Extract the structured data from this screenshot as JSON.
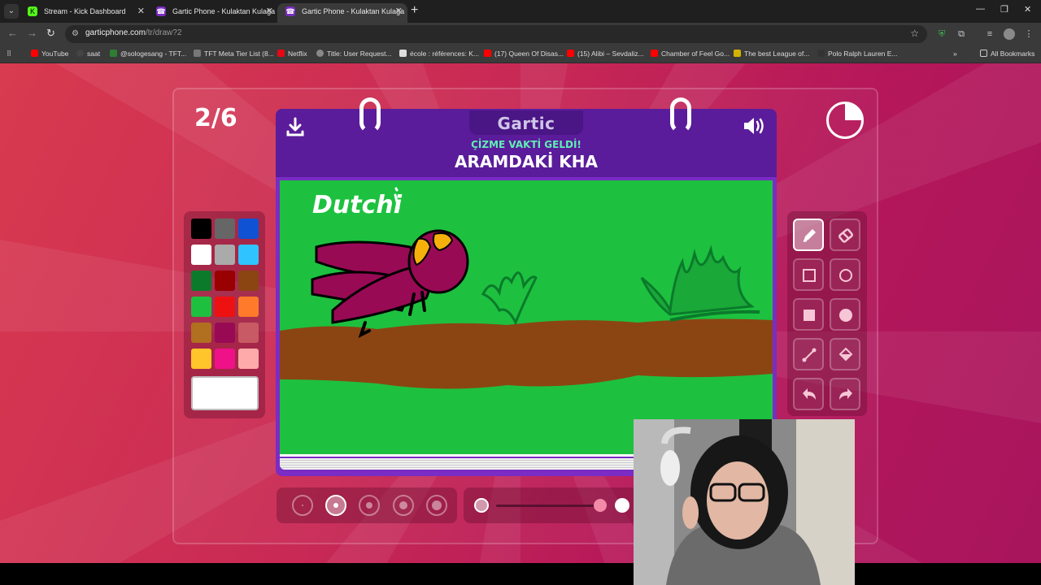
{
  "browser": {
    "tabs": [
      {
        "title": "Stream - Kick Dashboard",
        "active": false,
        "icon": "kick-icon"
      },
      {
        "title": "Gartic Phone - Kulaktan Kulağa",
        "active": false,
        "icon": "gartic-icon"
      },
      {
        "title": "Gartic Phone - Kulaktan Kulağa",
        "active": true,
        "icon": "gartic-icon"
      }
    ],
    "new_tab": "+",
    "url_host": "garticphone.com",
    "url_path": "/tr/draw?2",
    "bookmarks": [
      {
        "label": "YouTube",
        "color": "#ff0000"
      },
      {
        "label": "saat",
        "color": "#444444"
      },
      {
        "label": "@sologesang - TFT...",
        "color": "#2e7d32"
      },
      {
        "label": "TFT Meta Tier List (8...",
        "color": "#777777"
      },
      {
        "label": "Netflix",
        "color": "#e50914"
      },
      {
        "label": "Title: User Request...",
        "color": "#888888"
      },
      {
        "label": "école : références: K...",
        "color": "#dddddd"
      },
      {
        "label": "(17) Queen Of Disas...",
        "color": "#ff0000"
      },
      {
        "label": "(15) Alibi – Sevdaliz...",
        "color": "#ff0000"
      },
      {
        "label": "Chamber of Feel Go...",
        "color": "#ff0000"
      },
      {
        "label": "The best League of...",
        "color": "#d4b300"
      },
      {
        "label": "Polo Ralph Lauren E...",
        "color": "#333333"
      }
    ],
    "all_bookmarks": "All Bookmarks",
    "more_bookmarks": "»"
  },
  "game": {
    "round": "2/6",
    "logo": "Gartic",
    "prompt_label": "ÇİZME VAKTİ GELDİ!",
    "prompt": "ARAMDAKİ KHA",
    "canvas_text": "Dutchi",
    "palette": [
      "#000000",
      "#666666",
      "#0f52d4",
      "#ffffff",
      "#aaaaaa",
      "#2fc4ff",
      "#0b7a2b",
      "#990000",
      "#8b4513",
      "#1dc13f",
      "#ee1111",
      "#ff7a2a",
      "#b0701f",
      "#990a55",
      "#c75a64",
      "#ffc52a",
      "#ee1188",
      "#ffaaaa"
    ],
    "current_color": "#ffffff",
    "tools": [
      "pencil-icon",
      "eraser-icon",
      "rectangle-icon",
      "ellipse-icon",
      "filled-rectangle-icon",
      "filled-ellipse-icon",
      "line-icon",
      "bucket-icon",
      "undo-icon",
      "redo-icon"
    ],
    "active_tool": "pencil-icon",
    "brush_sizes": 5,
    "active_brush_size": 2
  }
}
